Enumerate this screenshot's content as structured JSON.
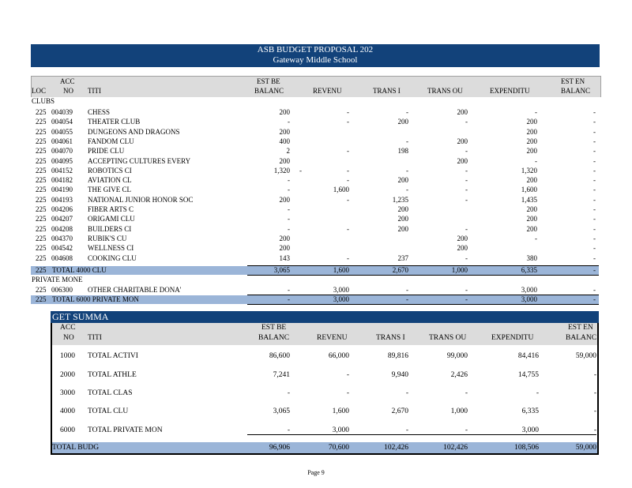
{
  "banner": {
    "title": "ASB BUDGET PROPOSAL 202",
    "subtitle": "Gateway Middle School"
  },
  "header": {
    "loc": "LOC",
    "acct_top": "ACC",
    "acct_bottom": "NO",
    "title": "TITI",
    "est_beg_top": "EST BE",
    "est_beg_bottom": "BALANC",
    "revenue": "REVENU",
    "trans_in": "TRANS I",
    "trans_out": "TRANS OU",
    "expenditure": "EXPENDITU",
    "est_end_top": "EST EN",
    "est_end_bottom": "BALANC"
  },
  "clubs_section": "CLUBS",
  "clubs": [
    {
      "loc": "225",
      "acct": "004039",
      "title": "CHESS",
      "beg": "200",
      "rev": "-",
      "tin": "-",
      "tout": "200",
      "exp": "-",
      "end": "-"
    },
    {
      "loc": "225",
      "acct": "004054",
      "title": "THEATER CLUB",
      "beg": "-",
      "rev": "-",
      "tin": "200",
      "tout": "-",
      "exp": "200",
      "end": "-"
    },
    {
      "loc": "225",
      "acct": "004055",
      "title": "DUNGEONS AND DRAGONS",
      "beg": "200",
      "rev": "",
      "tin": "",
      "tout": "",
      "exp": "200",
      "end": "-"
    },
    {
      "loc": "225",
      "acct": "004061",
      "title": "FANDOM CLU",
      "beg": "400",
      "rev": "",
      "tin": "-",
      "tout": "200",
      "exp": "200",
      "end": "-"
    },
    {
      "loc": "225",
      "acct": "004070",
      "title": "PRIDE CLU",
      "beg": "2",
      "rev": "-",
      "tin": "198",
      "tout": "-",
      "exp": "200",
      "end": "-"
    },
    {
      "loc": "225",
      "acct": "004095",
      "title": "ACCEPTING CULTURES EVERY",
      "beg": "200",
      "rev": "",
      "tin": "",
      "tout": "200",
      "exp": "-",
      "end": "-"
    },
    {
      "loc": "225",
      "acct": "004152",
      "title": "ROBOTICS CI",
      "beg": "1,320",
      "rev": "-",
      "tin": "-",
      "tout": "-",
      "exp": "1,320",
      "end": "-",
      "dash_after_beg": "-"
    },
    {
      "loc": "225",
      "acct": "004182",
      "title": "AVIATION CL",
      "beg": "-",
      "rev": "-",
      "tin": "200",
      "tout": "-",
      "exp": "200",
      "end": "-"
    },
    {
      "loc": "225",
      "acct": "004190",
      "title": "THE GIVE CL",
      "beg": "-",
      "rev": "1,600",
      "tin": "-",
      "tout": "-",
      "exp": "1,600",
      "end": "-"
    },
    {
      "loc": "225",
      "acct": "004193",
      "title": "NATIONAL JUNIOR HONOR SOC",
      "beg": "200",
      "rev": "-",
      "tin": "1,235",
      "tout": "-",
      "exp": "1,435",
      "end": "-"
    },
    {
      "loc": "225",
      "acct": "004206",
      "title": "FIBER ARTS C",
      "beg": "-",
      "rev": "",
      "tin": "200",
      "tout": "",
      "exp": "200",
      "end": "-"
    },
    {
      "loc": "225",
      "acct": "004207",
      "title": "ORIGAMI CLU",
      "beg": "-",
      "rev": "",
      "tin": "200",
      "tout": "",
      "exp": "200",
      "end": "-"
    },
    {
      "loc": "225",
      "acct": "004208",
      "title": "BUILDERS CI",
      "beg": "-",
      "rev": "-",
      "tin": "200",
      "tout": "-",
      "exp": "200",
      "end": "-"
    },
    {
      "loc": "225",
      "acct": "004370",
      "title": "RUBIK'S CU",
      "beg": "200",
      "rev": "",
      "tin": "",
      "tout": "200",
      "exp": "-",
      "end": "-"
    },
    {
      "loc": "225",
      "acct": "004542",
      "title": "WELLNESS CI",
      "beg": "200",
      "rev": "",
      "tin": "",
      "tout": "200",
      "exp": "",
      "end": "-"
    },
    {
      "loc": "225",
      "acct": "004608",
      "title": "COOKING CLU",
      "beg": "143",
      "rev": "-",
      "tin": "237",
      "tout": "-",
      "exp": "380",
      "end": "-"
    }
  ],
  "clubs_total": {
    "loc": "225",
    "title": "TOTAL 4000 CLU",
    "beg": "3,065",
    "rev": "1,600",
    "tin": "2,670",
    "tout": "1,000",
    "exp": "6,335",
    "end": "-"
  },
  "private_section": "PRIVATE MONE",
  "private": [
    {
      "loc": "225",
      "acct": "006300",
      "title": "OTHER CHARITABLE DONA'",
      "beg": "-",
      "rev": "3,000",
      "tin": "-",
      "tout": "-",
      "exp": "3,000",
      "end": "-"
    }
  ],
  "private_total": {
    "loc": "225",
    "title": "TOTAL 6000 PRIVATE MON",
    "beg": "-",
    "rev": "3,000",
    "tin": "-",
    "tout": "-",
    "exp": "3,000",
    "end": "-"
  },
  "summary": {
    "title": "GET SUMMA",
    "rows": [
      {
        "acct": "1000",
        "title": "TOTAL ACTIVI",
        "beg": "86,600",
        "rev": "66,000",
        "tin": "89,816",
        "tout": "99,000",
        "exp": "84,416",
        "end": "59,000"
      },
      {
        "acct": "2000",
        "title": "TOTAL ATHLE",
        "beg": "7,241",
        "rev": "-",
        "tin": "9,940",
        "tout": "2,426",
        "exp": "14,755",
        "end": "-"
      },
      {
        "acct": "3000",
        "title": "TOTAL CLAS",
        "beg": "-",
        "rev": "-",
        "tin": "-",
        "tout": "-",
        "exp": "-",
        "end": "-"
      },
      {
        "acct": "4000",
        "title": "TOTAL CLU",
        "beg": "3,065",
        "rev": "1,600",
        "tin": "2,670",
        "tout": "1,000",
        "exp": "6,335",
        "end": "-"
      },
      {
        "acct": "6000",
        "title": "TOTAL PRIVATE MON",
        "beg": "-",
        "rev": "3,000",
        "tin": "-",
        "tout": "-",
        "exp": "3,000",
        "end": "-"
      }
    ],
    "total": {
      "title": "TOTAL BUDG",
      "beg": "96,906",
      "rev": "70,600",
      "tin": "102,426",
      "tout": "102,426",
      "exp": "108,506",
      "end": "59,000"
    }
  },
  "footer": {
    "page": "Page 9"
  },
  "colors": {
    "banner": "#12427a",
    "total_bar": "#9bb5d8",
    "header_bg": "#dcdcdc"
  }
}
